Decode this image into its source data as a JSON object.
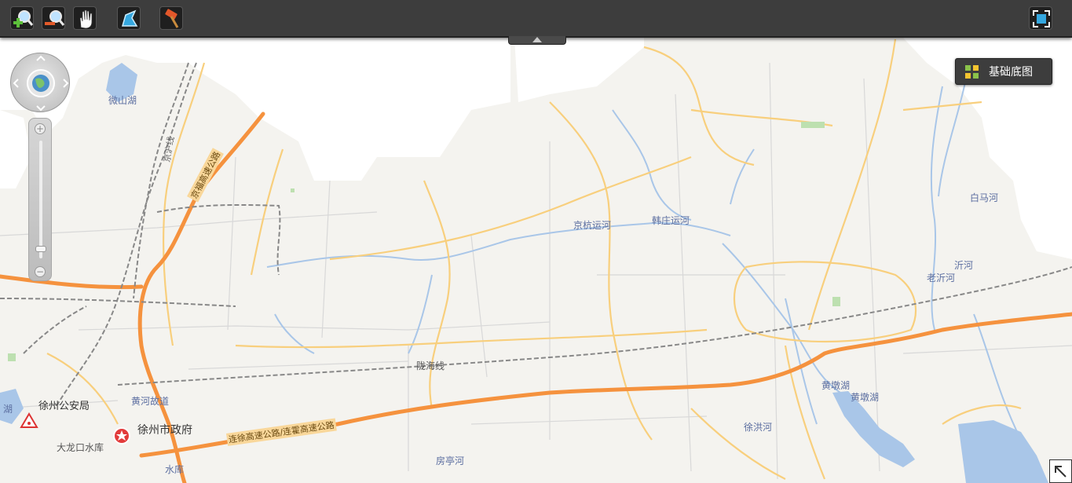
{
  "toolbar": {
    "buttons": [
      {
        "name": "zoom-in-tool",
        "icon": "magnifier-plus-icon"
      },
      {
        "name": "zoom-out-tool",
        "icon": "magnifier-minus-icon"
      },
      {
        "name": "pan-tool",
        "icon": "hand-icon"
      },
      {
        "name": "measure-tool",
        "icon": "shape-icon"
      },
      {
        "name": "hammer-tool",
        "icon": "hammer-icon"
      }
    ],
    "fullscreen_icon": "fullscreen-icon"
  },
  "basemap": {
    "label": "基础底图"
  },
  "navigation": {
    "pan_icon": "compass-globe-icon",
    "zoom_level_fraction": 0.08
  },
  "labels": {
    "weishan_lake": "微山湖",
    "jinghang_canal": "京杭运河",
    "hanzhuang_canal": "韩庄运河",
    "baima_river": "白马河",
    "yi_river": "沂河",
    "lao_yi_river": "老沂河",
    "longhai_line": "陇海线",
    "xuzhou_police": "徐州公安局",
    "huanghe_ancient": "黄河故道",
    "xuzhou_gov": "徐州市政府",
    "dalongkou": "大龙口水库",
    "xuzhou_hu": "湖",
    "fangting_river": "房亭河",
    "xuhong_river": "徐洪河",
    "huangdun_lake_1": "黄墩湖",
    "huangdun_lake_2": "黄墩湖",
    "highway": "连徐高速公路/连霍高速公路",
    "jingfu_highway": "京福高速公路",
    "jinghu_rail": "京沪线",
    "reservoir_bottom": "水库"
  },
  "colors": {
    "land": "#f4f3ef",
    "water": "#a9c6e8",
    "highway": "#f5923e",
    "road": "#f8cf7d",
    "minor_road": "#dcdcdc",
    "rail": "#888888"
  }
}
